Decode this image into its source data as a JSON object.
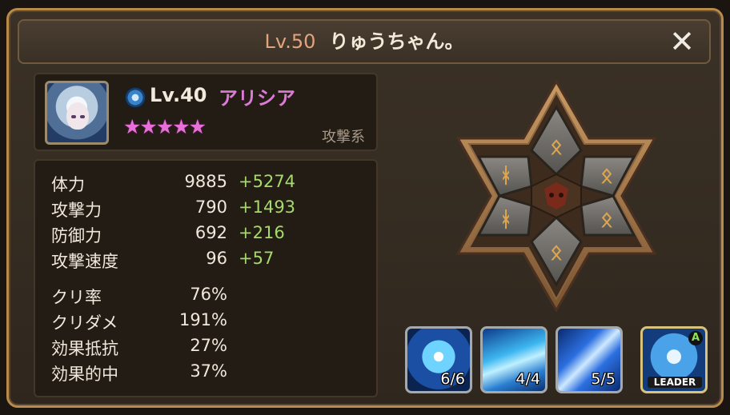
{
  "header": {
    "player_level": "Lv.50",
    "player_name": "りゅうちゃん。",
    "close_icon": "✕"
  },
  "monster": {
    "element": "water-element-icon",
    "level": "Lv.40",
    "name": "アリシア",
    "stars": "★★★★★",
    "star_count": 5,
    "type": "攻撃系"
  },
  "stats": [
    {
      "label": "体力",
      "value": "9885",
      "bonus": "+5274"
    },
    {
      "label": "攻撃力",
      "value": "790",
      "bonus": "+1493"
    },
    {
      "label": "防御力",
      "value": "692",
      "bonus": "+216"
    },
    {
      "label": "攻撃速度",
      "value": "96",
      "bonus": "+57"
    }
  ],
  "substats": [
    {
      "label": "クリ率",
      "value": "76%"
    },
    {
      "label": "クリダメ",
      "value": "191%"
    },
    {
      "label": "効果抵抗",
      "value": "27%"
    },
    {
      "label": "効果的中",
      "value": "37%"
    }
  ],
  "skills": [
    {
      "count": "6/6",
      "icon": "ice-burst-skill-icon"
    },
    {
      "count": "4/4",
      "icon": "ice-whirl-skill-icon"
    },
    {
      "count": "5/5",
      "icon": "ice-shards-skill-icon"
    }
  ],
  "leader": {
    "label": "LEADER",
    "badge": "A",
    "icon": "sword-leader-skill-icon"
  },
  "colors": {
    "frame_border": "#b98b4a",
    "player_level": "#e2a47e",
    "monster_name": "#dc7bd6",
    "stars": "#e86fd8",
    "bonus": "#a6da6a"
  }
}
